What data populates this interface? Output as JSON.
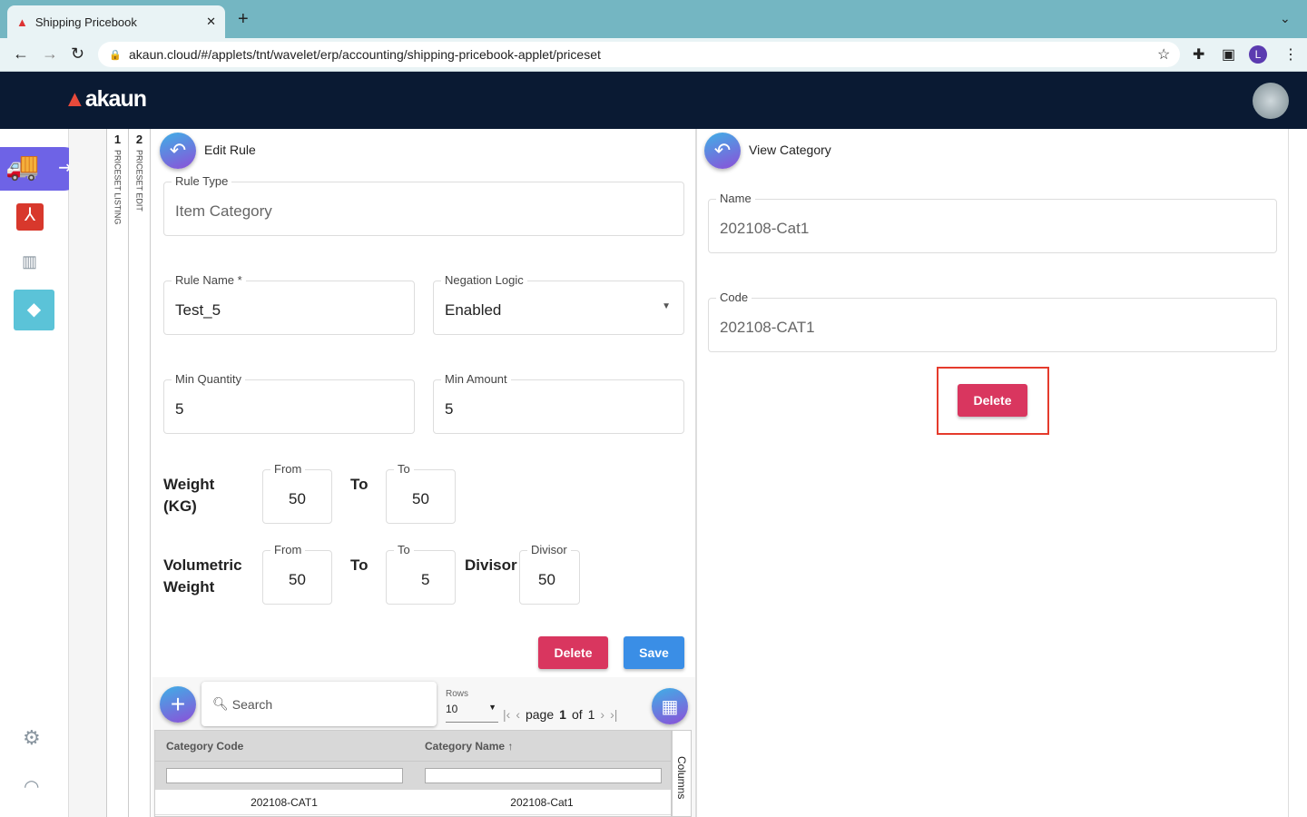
{
  "browser": {
    "tab_title": "Shipping Pricebook",
    "url": "akaun.cloud/#/applets/tnt/wavelet/erp/accounting/shipping-pricebook-applet/priceset",
    "profile_initial": "L"
  },
  "app": {
    "logo": "akaun"
  },
  "sidebar": {
    "items": [
      {
        "icon": "truck-icon"
      },
      {
        "icon": "app-icon"
      },
      {
        "icon": "book-icon"
      },
      {
        "icon": "tag-icon"
      },
      {
        "icon": "gear-icon"
      },
      {
        "icon": "user-icon"
      }
    ]
  },
  "breadcrumbs": [
    {
      "num": "1",
      "label": "PRICESET LISTING"
    },
    {
      "num": "2",
      "label": "PRICESET EDIT"
    }
  ],
  "edit_rule": {
    "title": "Edit Rule",
    "rule_type": {
      "label": "Rule Type",
      "value": "Item Category"
    },
    "rule_name": {
      "label": "Rule Name *",
      "value": "Test_5"
    },
    "negation": {
      "label": "Negation Logic",
      "value": "Enabled"
    },
    "min_qty": {
      "label": "Min Quantity",
      "value": "5"
    },
    "min_amt": {
      "label": "Min Amount",
      "value": "5"
    },
    "weight": {
      "label1": "Weight",
      "label2": "(KG)",
      "from_label": "From",
      "from": "50",
      "to_text": "To",
      "to_label": "To",
      "to": "50"
    },
    "vol": {
      "label1": "Volumetric",
      "label2": "Weight",
      "from_label": "From",
      "from": "50",
      "to_text": "To",
      "to_label": "To",
      "to": "5",
      "divisor_text": "Divisor",
      "divisor_label": "Divisor",
      "divisor": "50"
    },
    "delete": "Delete",
    "save": "Save"
  },
  "grid": {
    "search_placeholder": "Search",
    "rows_label": "Rows",
    "rows": "10",
    "page_word": "page",
    "page": "1",
    "of_word": "of",
    "total": "1",
    "columns_label": "Columns",
    "headers": [
      "Category Code",
      "Category Name"
    ],
    "sort_arrow": "↑",
    "rows_data": [
      [
        "202108-CAT1",
        "202108-Cat1"
      ]
    ]
  },
  "view_category": {
    "title": "View Category",
    "name": {
      "label": "Name",
      "value": "202108-Cat1"
    },
    "code": {
      "label": "Code",
      "value": "202108-CAT1"
    },
    "delete": "Delete"
  },
  "colors": {
    "accent_red": "#d9365f",
    "accent_blue": "#3a8ee6",
    "header": "#0a1a33",
    "highlight": "#e53b2c"
  }
}
